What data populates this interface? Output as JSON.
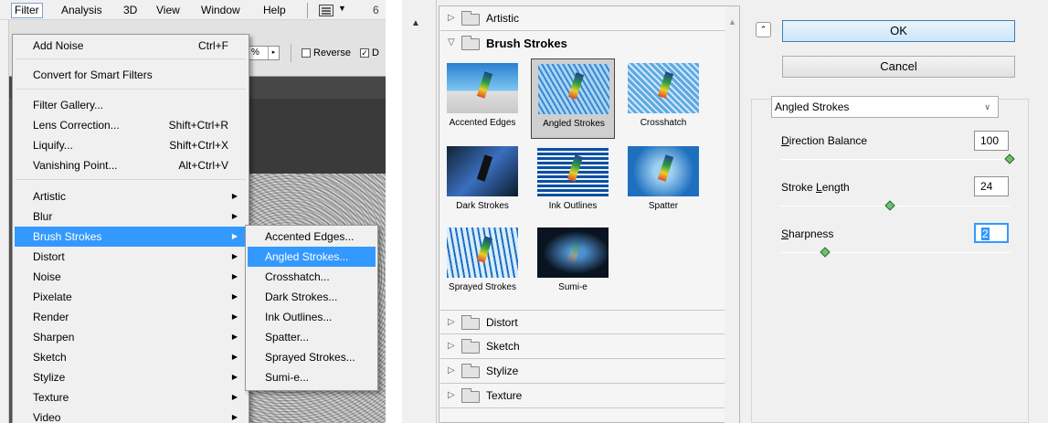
{
  "menubar": {
    "items": [
      "Filter",
      "Analysis",
      "3D",
      "View",
      "Window",
      "Help"
    ],
    "overflow": "6"
  },
  "options_bar": {
    "select_value": "%",
    "reverse_label": "Reverse",
    "dither_label": "D",
    "reverse_checked": false,
    "dither_checked": true
  },
  "filter_menu": {
    "add_noise": {
      "label": "Add Noise",
      "shortcut": "Ctrl+F"
    },
    "convert_smart": {
      "label": "Convert for Smart Filters"
    },
    "filter_gallery": {
      "label": "Filter Gallery..."
    },
    "lens_correction": {
      "label": "Lens Correction...",
      "shortcut": "Shift+Ctrl+R"
    },
    "liquify": {
      "label": "Liquify...",
      "shortcut": "Shift+Ctrl+X"
    },
    "vanishing_point": {
      "label": "Vanishing Point...",
      "shortcut": "Alt+Ctrl+V"
    },
    "categories": [
      "Artistic",
      "Blur",
      "Brush Strokes",
      "Distort",
      "Noise",
      "Pixelate",
      "Render",
      "Sharpen",
      "Sketch",
      "Stylize",
      "Texture",
      "Video"
    ],
    "selected_category": "Brush Strokes"
  },
  "sub_menu": {
    "items": [
      "Accented Edges...",
      "Angled Strokes...",
      "Crosshatch...",
      "Dark Strokes...",
      "Ink Outlines...",
      "Spatter...",
      "Sprayed Strokes...",
      "Sumi-e..."
    ],
    "selected_item": "Angled Strokes..."
  },
  "gallery": {
    "categories_top": [
      "Artistic"
    ],
    "open_category": "Brush Strokes",
    "thumbnails": [
      "Accented Edges",
      "Angled Strokes",
      "Crosshatch",
      "Dark Strokes",
      "Ink Outlines",
      "Spatter",
      "Sprayed Strokes",
      "Sumi-e"
    ],
    "selected_thumbnail": "Angled Strokes",
    "categories_bottom": [
      "Distort",
      "Sketch",
      "Stylize",
      "Texture"
    ]
  },
  "settings": {
    "ok_label": "OK",
    "cancel_label": "Cancel",
    "filter_select": "Angled Strokes",
    "params": [
      {
        "label_pre": "",
        "label_ul": "D",
        "label_post": "irection Balance",
        "value": "100",
        "level": 1.0
      },
      {
        "label_pre": "Stroke ",
        "label_ul": "L",
        "label_post": "ength",
        "value": "24",
        "level": 0.48
      },
      {
        "label_pre": "",
        "label_ul": "S",
        "label_post": "harpness",
        "value": "2",
        "level": 0.2
      }
    ]
  },
  "colors": {
    "menu_highlight": "#3399ff",
    "knob": "#6fbf6f"
  }
}
